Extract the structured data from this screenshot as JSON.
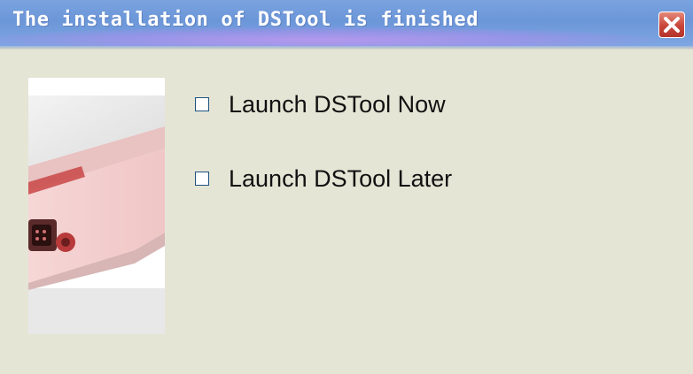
{
  "window": {
    "title": "The installation of DSTool is finished",
    "close_icon": "close-icon"
  },
  "side_image": {
    "description_icon": "device-photo"
  },
  "options": [
    {
      "label": "Launch DSTool Now",
      "checked": false
    },
    {
      "label": "Launch DSTool Later",
      "checked": false
    }
  ],
  "colors": {
    "titlebar": "#6b96d8",
    "window_bg": "#e5e5d6",
    "close_button": "#c9453a",
    "device_accent": "#c04040"
  }
}
